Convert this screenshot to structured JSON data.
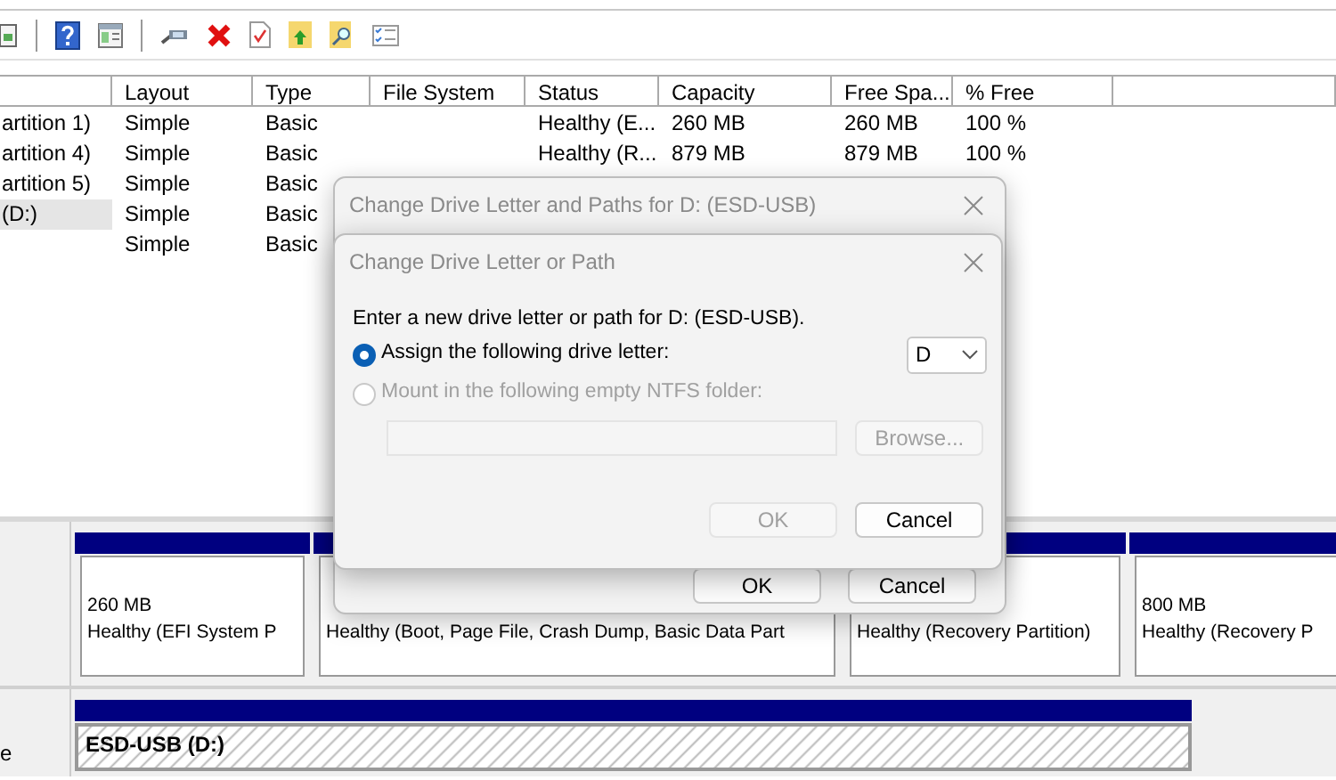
{
  "volume_table": {
    "columns": [
      "",
      "Layout",
      "Type",
      "File System",
      "Status",
      "Capacity",
      "Free Spa...",
      "% Free"
    ],
    "rows": [
      {
        "selected": false,
        "cells": [
          "artition 1)",
          "Simple",
          "Basic",
          "",
          "Healthy (E...",
          "260 MB",
          "260 MB",
          "100 %"
        ]
      },
      {
        "selected": false,
        "cells": [
          "artition 4)",
          "Simple",
          "Basic",
          "",
          "Healthy (R...",
          "879 MB",
          "879 MB",
          "100 %"
        ]
      },
      {
        "selected": false,
        "cells": [
          "artition 5)",
          "Simple",
          "Basic",
          "",
          "",
          "",
          "",
          ""
        ]
      },
      {
        "selected": true,
        "cells": [
          "(D:)",
          "Simple",
          "Basic",
          "",
          "",
          "",
          "",
          ""
        ]
      },
      {
        "selected": false,
        "cells": [
          "",
          "Simple",
          "Basic",
          "",
          "",
          "",
          "",
          ""
        ]
      }
    ]
  },
  "disk_map": {
    "disks": [
      {
        "partitions": [
          {
            "kind": "primary",
            "lines": [
              "260 MB",
              "Healthy (EFI System P"
            ]
          },
          {
            "kind": "primary",
            "lines": [
              "Healthy (Boot, Page File, Crash Dump, Basic Data Part"
            ]
          },
          {
            "kind": "primary",
            "lines": [
              "Healthy (Recovery Partition)"
            ]
          },
          {
            "kind": "primary",
            "lines": [
              "800 MB",
              "Healthy (Recovery P"
            ]
          }
        ]
      },
      {
        "label": "e",
        "partitions": [
          {
            "kind": "selected",
            "lines": [
              "ESD-USB  (D:)"
            ]
          }
        ]
      }
    ]
  },
  "back_dialog": {
    "title": "Change Drive Letter and Paths for D: (ESD-USB)",
    "buttons": [
      {
        "label": "OK",
        "disabled": false
      },
      {
        "label": "Cancel",
        "disabled": false
      }
    ]
  },
  "dialog": {
    "title": "Change Drive Letter or Path",
    "prompt": "Enter a new drive letter or path for D: (ESD-USB).",
    "options": [
      {
        "label": "Assign the following drive letter:",
        "selected": true,
        "disabled": false
      },
      {
        "label": "Mount in the following empty NTFS folder:",
        "selected": false,
        "disabled": true
      }
    ],
    "drive_letter": "D",
    "folder_path": {
      "disabled": true
    },
    "browse_button": {
      "label": "Browse...",
      "disabled": true
    },
    "buttons": [
      {
        "label": "OK",
        "disabled": true
      },
      {
        "label": "Cancel",
        "disabled": false
      }
    ]
  }
}
